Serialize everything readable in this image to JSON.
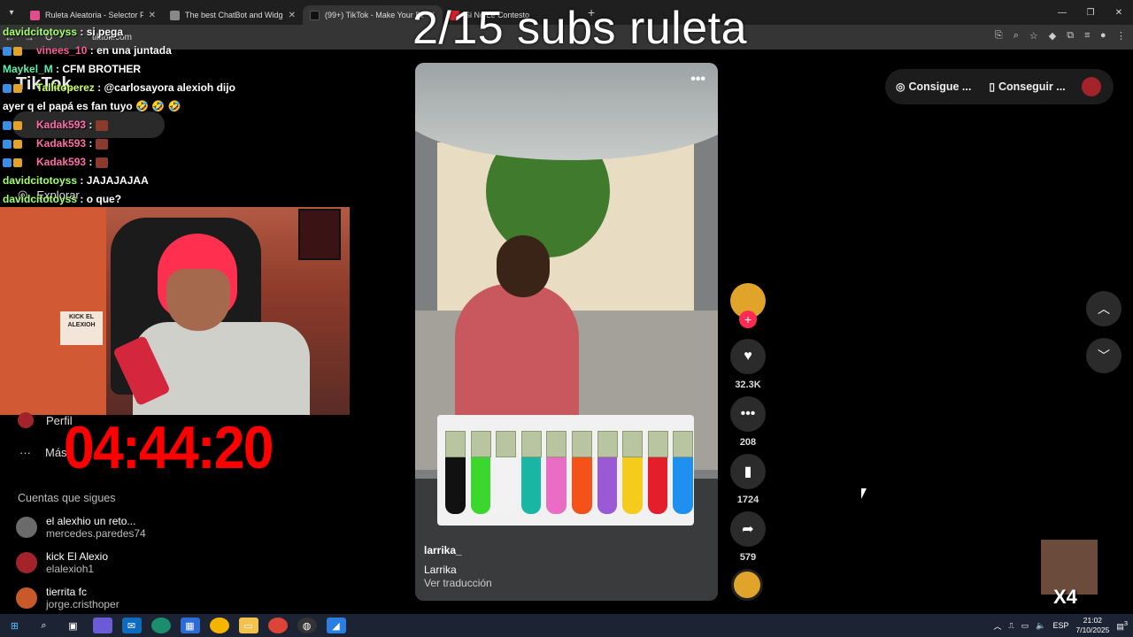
{
  "browser": {
    "tabs": [
      {
        "title": "Ruleta Aleatoria - Selector Pers",
        "active": false,
        "color": "#e34c8b"
      },
      {
        "title": "The best ChatBot and Widgets",
        "active": false,
        "color": "#888888"
      },
      {
        "title": "(99+) TikTok - Make Your Da",
        "active": true,
        "color": "#111111"
      },
      {
        "title": "Si No Le Contesto",
        "active": false,
        "color": "#d2232a"
      }
    ],
    "url": "tiktok.com"
  },
  "overlay": {
    "title": "2/15 subs ruleta"
  },
  "chat": [
    {
      "user": "davidcitotoyss",
      "text": "si pega",
      "cls": "u1",
      "badges": 0
    },
    {
      "user": "vinees_10",
      "text": "en una juntada",
      "cls": "u2",
      "badges": 2
    },
    {
      "user": "Maykel_M",
      "text": "CFM BROTHER",
      "cls": "u3",
      "badges": 0
    },
    {
      "user": "Tallitoperez",
      "text": "@carlosayora alexioh dijo",
      "cls": "u4",
      "badges": 2
    },
    {
      "user": "",
      "text": "ayer q el papá es fan tuyo 🤣 🤣 🤣",
      "cls": "u4",
      "badges": 0
    },
    {
      "user": "Kadak593",
      "text": "",
      "cls": "u5",
      "badges": 2
    },
    {
      "user": "Kadak593",
      "text": "",
      "cls": "u5",
      "badges": 2
    },
    {
      "user": "Kadak593",
      "text": "",
      "cls": "u5",
      "badges": 2
    },
    {
      "user": "davidcitotoyss",
      "text": "JAJAJAJAA",
      "cls": "u1",
      "badges": 0
    },
    {
      "user": "davidcitotoyss",
      "text": "o que?",
      "cls": "u1",
      "badges": 0
    }
  ],
  "tiktok": {
    "logo": "TikTok",
    "explore": "Explorar",
    "profile": "Perfil",
    "more": "Más",
    "following_title": "Cuentas que sigues",
    "accounts": [
      {
        "name": "el alexhio un reto...",
        "handle": "mercedes.paredes74",
        "color": "#6b6b6b"
      },
      {
        "name": "kick El Alexio",
        "handle": "elalexioh1",
        "color": "#a3232b"
      },
      {
        "name": "tierrita fc",
        "handle": "jorge.cristhoper",
        "color": "#c85a2a"
      }
    ],
    "header_btn1": "Consigue ...",
    "header_btn2": "Conseguir ..."
  },
  "stream": {
    "timer": "04:44:20",
    "sign": "KICK EL ALEXIOH"
  },
  "video": {
    "author": "larrika_",
    "description": "Larrika",
    "translate": "Ver traducción",
    "tube_colors": [
      "#111111",
      "#3bd72e",
      "#f2f2f2",
      "#19b7a3",
      "#e96cc5",
      "#f5521a",
      "#9a5ad6",
      "#f5cb1c",
      "#e41e2b",
      "#1f8ff0"
    ]
  },
  "actions": {
    "likes": "32.3K",
    "comments": "208",
    "saves": "1724",
    "shares": "579"
  },
  "meme": {
    "label": "X4"
  },
  "taskbar": {
    "lang": "ESP",
    "time": "21:02",
    "date": "7/10/2025",
    "notif": "3"
  }
}
